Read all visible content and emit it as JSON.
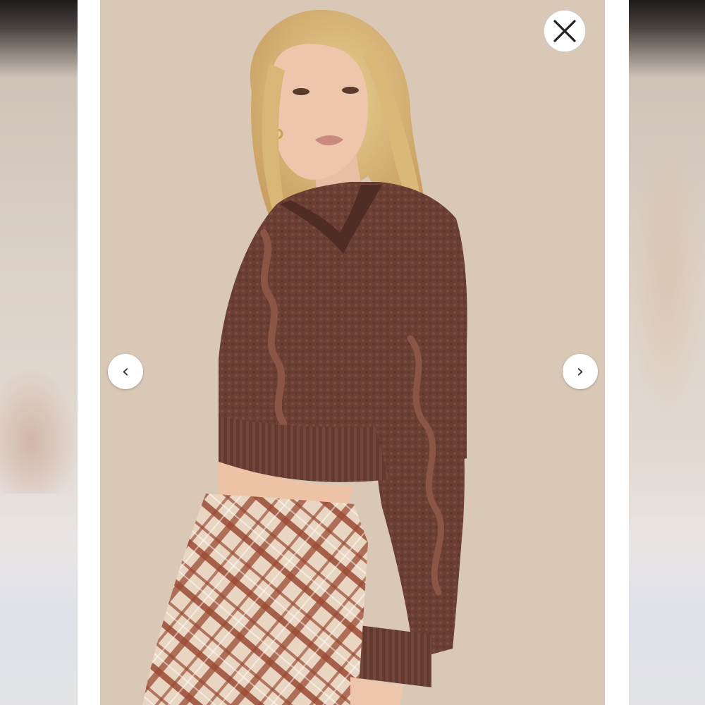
{
  "viewer": {
    "controls": {
      "close_icon": "close-icon",
      "prev_icon": "chevron-left-icon",
      "next_icon": "chevron-right-icon",
      "prev_glyph": "‹",
      "next_glyph": "›"
    },
    "colors": {
      "photo_background": "#dac8b6",
      "sweater": "#6b3f34",
      "skirt_base": "#e8d6c2",
      "skirt_plaid": "#9a4a33"
    }
  }
}
